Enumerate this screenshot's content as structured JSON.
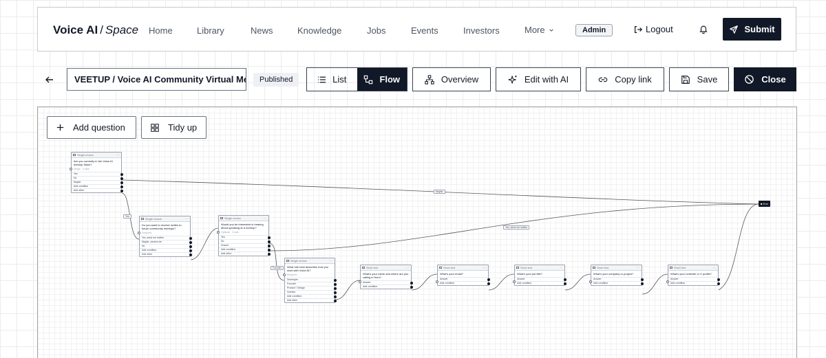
{
  "header": {
    "brand": "Voice AI",
    "brand_separator": "/",
    "brand_space": "Space",
    "nav": [
      "Home",
      "Library",
      "News",
      "Knowledge",
      "Jobs",
      "Events",
      "Investors"
    ],
    "more_label": "More",
    "admin_label": "Admin",
    "logout_label": "Logout",
    "submit_label": "Submit"
  },
  "toolbar": {
    "title_value": "VEETUP / Voice AI Community Virtual Meetup",
    "status": "Published",
    "list_label": "List",
    "flow_label": "Flow",
    "overview_label": "Overview",
    "edit_ai_label": "Edit with AI",
    "copy_link_label": "Copy link",
    "save_label": "Save",
    "close_label": "Close"
  },
  "canvas": {
    "add_question_label": "Add question",
    "tidy_up_label": "Tidy up",
    "end_label": "End",
    "nodes": [
      {
        "type": "Single choice",
        "question": "Are you currently in the Voice AI meetup Slack?",
        "sub": "Single · 3 opts",
        "options": [
          "Yes",
          "No",
          "Maybe",
          "Add condition",
          "Add other"
        ]
      },
      {
        "type": "Single choice",
        "question": "Do you want to receive invites to future community meetups?",
        "sub": "Required",
        "options": [
          "Yes, send me invites",
          "Maybe, remind me",
          "No",
          "Add condition",
          "Add other"
        ]
      },
      {
        "type": "Single choice",
        "question": "Would you be interested in hearing about speaking at a meetup?",
        "sub": "Optional · 3 opts",
        "options": [
          "Yes",
          "No",
          "Unsure",
          "Add condition",
          "Add other"
        ]
      },
      {
        "type": "Single choice",
        "question": "What role best describes how you work with Voice AI?",
        "sub": "Required",
        "options": [
          "Developer",
          "Founder",
          "Product / Design",
          "Investor",
          "Add condition",
          "Add other"
        ]
      },
      {
        "type": "Short text",
        "question": "What's your name and where are you calling in from?",
        "sub": "",
        "options": [
          "Answer",
          "Add condition"
        ]
      },
      {
        "type": "Short text",
        "question": "What's your email?",
        "sub": "",
        "options": [
          "Answer",
          "Add condition"
        ]
      },
      {
        "type": "Short text",
        "question": "What's your job title?",
        "sub": "",
        "options": [
          "Answer",
          "Add condition"
        ]
      },
      {
        "type": "Short text",
        "question": "What's your company or project?",
        "sub": "",
        "options": [
          "Answer",
          "Add condition"
        ]
      },
      {
        "type": "Short text",
        "question": "What's your LinkedIn or X profile?",
        "sub": "",
        "options": [
          "Answer",
          "Add condition"
        ]
      }
    ],
    "edge_labels": [
      "Maybe",
      "Yes",
      "Yes, send me invites",
      "Founder"
    ]
  }
}
